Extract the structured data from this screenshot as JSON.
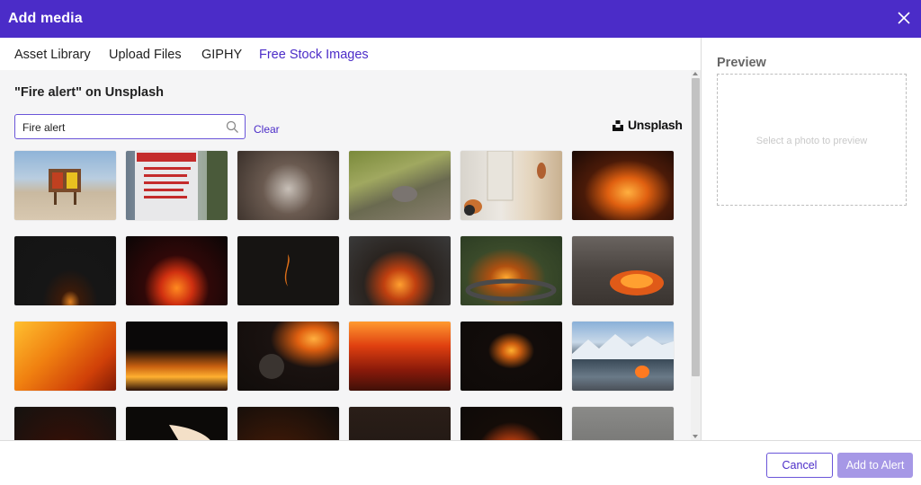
{
  "dialog": {
    "title": "Add media",
    "close_icon": "close-icon"
  },
  "tabs": [
    {
      "label": "Asset Library",
      "active": false
    },
    {
      "label": "Upload Files",
      "active": false
    },
    {
      "label": "GIPHY",
      "active": false
    },
    {
      "label": "Free Stock Images",
      "active": true
    }
  ],
  "stock": {
    "heading": "\"Fire alert\" on Unsplash",
    "search_value": "Fire alert",
    "search_icon": "search-icon",
    "clear_label": "Clear",
    "provider_name": "Unsplash"
  },
  "photos": [
    {
      "desc": "smokey-bear-sign"
    },
    {
      "desc": "no-camping-sign"
    },
    {
      "desc": "dry-branches"
    },
    {
      "desc": "bird-on-branches"
    },
    {
      "desc": "cat-in-hallway"
    },
    {
      "desc": "bonfire-sparks"
    },
    {
      "desc": "dark-small-flame"
    },
    {
      "desc": "campfire-dark"
    },
    {
      "desc": "single-flame"
    },
    {
      "desc": "campfire-night-sparks"
    },
    {
      "desc": "fire-pit-garden"
    },
    {
      "desc": "logs-burning-field"
    },
    {
      "desc": "flames-closeup"
    },
    {
      "desc": "grass-fire-line"
    },
    {
      "desc": "burning-match"
    },
    {
      "desc": "embers-bed"
    },
    {
      "desc": "flying-flame"
    },
    {
      "desc": "mountain-lake-campfire"
    },
    {
      "desc": "fire-dark-bottom"
    },
    {
      "desc": "hand-flame"
    },
    {
      "desc": "small-flames-dark"
    },
    {
      "desc": "dark-brown"
    },
    {
      "desc": "sparkler-fire"
    },
    {
      "desc": "hazy-field"
    }
  ],
  "preview": {
    "label": "Preview",
    "hint": "Select a photo to preview"
  },
  "footer": {
    "cancel_label": "Cancel",
    "add_label": "Add to Alert"
  },
  "colors": {
    "accent": "#4b2cc8",
    "disabled_primary": "#a698e6"
  }
}
